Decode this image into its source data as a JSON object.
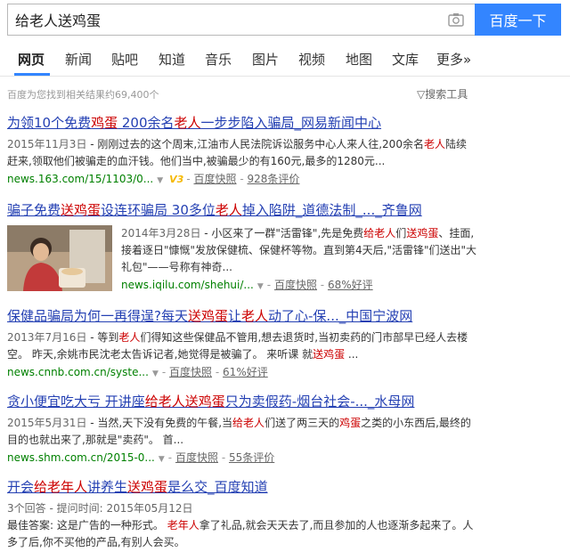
{
  "search": {
    "query": "给老人送鸡蛋",
    "button_label": "百度一下"
  },
  "tabs": [
    "网页",
    "新闻",
    "贴吧",
    "知道",
    "音乐",
    "图片",
    "视频",
    "地图",
    "文库",
    "更多»"
  ],
  "result_count": "百度为您找到相关结果约69,400个",
  "tools_label": "搜索工具",
  "results": [
    {
      "title": [
        {
          "t": "为领10个免费"
        },
        {
          "t": "鸡蛋",
          "hl": true
        },
        {
          "t": " 200余名"
        },
        {
          "t": "老人",
          "hl": true
        },
        {
          "t": "一步步陷入骗局_网易新闻中心"
        }
      ],
      "abstract": [
        {
          "t": "2015年11月3日",
          "date": true
        },
        {
          "t": " - 刚刚过去的这个周末,江油市人民法院诉讼服务中心人来人往,200余名"
        },
        {
          "t": "老人",
          "hl": true
        },
        {
          "t": "陆续赶来,领取他们被骗走的血汗钱。他们当中,被骗最少的有160元,最多的1280元..."
        }
      ],
      "url": "news.163.com/15/1103/0...",
      "badge": "V3",
      "snapshot": "百度快照",
      "extra": "928条评价"
    },
    {
      "title": [
        {
          "t": "骗子免费"
        },
        {
          "t": "送鸡蛋",
          "hl": true
        },
        {
          "t": "设连环骗局 30多位"
        },
        {
          "t": "老人",
          "hl": true
        },
        {
          "t": "掉入陷阱_道德法制_..._齐鲁网"
        }
      ],
      "abstract": [
        {
          "t": "2014年3月28日",
          "date": true
        },
        {
          "t": " - 小区来了一群\"活雷锋\",先是免费"
        },
        {
          "t": "给老人",
          "hl": true
        },
        {
          "t": "们"
        },
        {
          "t": "送鸡蛋",
          "hl": true
        },
        {
          "t": "、挂面,接着逐日\"慷慨\"发放保健梳、保健杯等物。直到第4天后,\"活雷锋\"们送出\"大礼包\"——号称有神奇..."
        }
      ],
      "url": "news.iqilu.com/shehui/...",
      "snapshot": "百度快照",
      "extra": "68%好评"
    },
    {
      "title": [
        {
          "t": "保健品骗局为何一再得逞?每天"
        },
        {
          "t": "送鸡蛋",
          "hl": true
        },
        {
          "t": "让"
        },
        {
          "t": "老人",
          "hl": true
        },
        {
          "t": "动了心-保..._中国宁波网"
        }
      ],
      "abstract": [
        {
          "t": "2013年7月16日",
          "date": true
        },
        {
          "t": " - 等到"
        },
        {
          "t": "老人",
          "hl": true
        },
        {
          "t": "们得知这些保健品不管用,想去退货时,当初卖药的门市部早已经人去楼空。 昨天,余姚市民沈老太告诉记者,她觉得是被骗了。 来听课 就"
        },
        {
          "t": "送鸡蛋",
          "hl": true
        },
        {
          "t": " ..."
        }
      ],
      "url": "news.cnnb.com.cn/syste...",
      "snapshot": "百度快照",
      "extra": "61%好评"
    },
    {
      "title": [
        {
          "t": "贪小便宜吃大亏 开讲座"
        },
        {
          "t": "给老人送鸡蛋",
          "hl": true
        },
        {
          "t": "只为卖假药-烟台社会-..._水母网"
        }
      ],
      "abstract": [
        {
          "t": "2015年5月31日",
          "date": true
        },
        {
          "t": " - 当然,天下没有免费的午餐,当"
        },
        {
          "t": "给老人",
          "hl": true
        },
        {
          "t": "们送了两三天的"
        },
        {
          "t": "鸡蛋",
          "hl": true
        },
        {
          "t": "之类的小东西后,最终的目的也就出来了,那就是\"卖药\"。 首..."
        }
      ],
      "url": "news.shm.com.cn/2015-0...",
      "snapshot": "百度快照",
      "extra": "55条评价"
    },
    {
      "title": [
        {
          "t": "开会"
        },
        {
          "t": "给老年人",
          "hl": true
        },
        {
          "t": "讲养生"
        },
        {
          "t": "送鸡蛋",
          "hl": true
        },
        {
          "t": "是么交_百度知道"
        }
      ],
      "meta_line": "3个回答 - 提问时间: 2015年05月12日",
      "abstract": [
        {
          "t": "最佳答案: 这是广告的一种形式。 "
        },
        {
          "t": "老年人",
          "hl": true
        },
        {
          "t": "拿了礼品,就会天天去了,而且参加的人也逐渐多起来了。人多了后,你不买他的产品,有别人会买。"
        }
      ]
    }
  ],
  "colors": {
    "link": "#2440b3",
    "highlight": "#cc0000",
    "url": "#008000",
    "accent": "#3385ff"
  }
}
